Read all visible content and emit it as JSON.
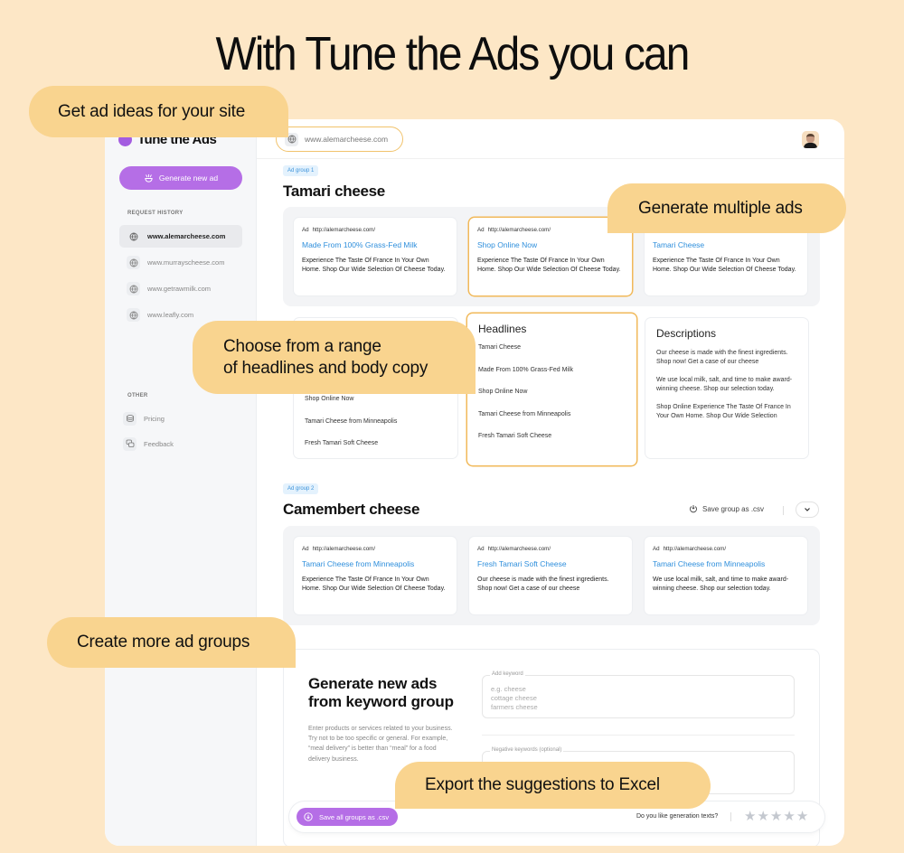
{
  "headline": "With Tune the Ads you can",
  "callouts": {
    "ideas": "Get ad ideas for your site",
    "multiple": "Generate multiple ads",
    "range_line1": "Choose from a range",
    "range_line2": "of headlines and body copy",
    "groups": "Create more ad groups",
    "export": "Export the suggestions to Excel"
  },
  "app": {
    "brand": "Tune the Ads",
    "generate_button": "Generate new ad",
    "request_history_label": "REQUEST HISTORY",
    "history": [
      {
        "url": "www.alemarcheese.com",
        "active": true
      },
      {
        "url": "www.murrayscheese.com",
        "active": false
      },
      {
        "url": "www.getrawmilk.com",
        "active": false
      },
      {
        "url": "www.leafly.com",
        "active": false
      }
    ],
    "other_label": "OTHER",
    "other_items": [
      {
        "label": "Pricing",
        "icon": "coins-icon"
      },
      {
        "label": "Feedback",
        "icon": "chat-icon"
      }
    ],
    "url_input": "www.alemarcheese.com",
    "groups": [
      {
        "tag": "Ad group 1",
        "title": "Tamari cheese",
        "ads": [
          {
            "ad_label": "Ad",
            "url": "http://alemarcheese.com/",
            "title": "Made From 100% Grass-Fed Milk",
            "body": "Experience The Taste Of France In Your Own Home. Shop Our Wide Selection Of Cheese Today."
          },
          {
            "ad_label": "Ad",
            "url": "http://alemarcheese.com/",
            "title": "Shop Online Now",
            "body": "Experience The Taste Of France In Your Own Home. Shop Our Wide Selection Of Cheese Today."
          },
          {
            "ad_label": "Ad",
            "url": "http://alemarcheese.com/",
            "title": "Tamari Cheese",
            "body": "Experience The Taste Of France In Your Own Home. Shop Our Wide Selection Of Cheese Today."
          }
        ],
        "left_list": [
          "Shop Online Now",
          "Tamari Cheese from Minneapolis",
          "Fresh Tamari Soft Cheese"
        ],
        "headlines_title": "Headlines",
        "headlines": [
          "Tamari Cheese",
          "Made From 100% Grass-Fed Milk",
          "Shop Online Now",
          "Tamari Cheese from Minneapolis",
          "Fresh Tamari Soft Cheese"
        ],
        "descriptions_title": "Descriptions",
        "descriptions": [
          "Our cheese is made with the finest ingredients. Shop now! Get a case of our cheese",
          "We use local milk, salt, and time to make award-winning cheese. Shop our selection today.",
          "Shop Online Experience The Taste Of France In Your Own Home. Shop Our Wide Selection"
        ]
      },
      {
        "tag": "Ad group 2",
        "title": "Camembert cheese",
        "save_label": "Save group as .csv",
        "ads": [
          {
            "ad_label": "Ad",
            "url": "http://alemarcheese.com/",
            "title": "Tamari Cheese from Minneapolis",
            "body": "Experience The Taste Of France In Your Own Home. Shop Our Wide Selection Of Cheese Today."
          },
          {
            "ad_label": "Ad",
            "url": "http://alemarcheese.com/",
            "title": "Fresh Tamari Soft Cheese",
            "body": "Our cheese is made with the finest ingredients. Shop now! Get a case of our cheese"
          },
          {
            "ad_label": "Ad",
            "url": "http://alemarcheese.com/",
            "title": "Tamari Cheese from Minneapolis",
            "body": "We use local milk, salt, and time to make award-winning cheese. Shop our selection today."
          }
        ]
      }
    ],
    "keyword_section": {
      "title": "Generate new ads from keyword group",
      "description": "Enter products or services related to your business. Try not to be too specific or general. For example, “meal delivery” is better than “meal” for a food delivery business.",
      "keyword_label": "Add keyword",
      "keyword_placeholder": "e.g. cheese\ncottage cheese\nfarmers cheese",
      "negative_label": "Negative keywords (optional)"
    },
    "bottom_bar": {
      "save_all": "Save all groups as .csv",
      "rating_question": "Do you like generation texts?",
      "rating_stars": 0,
      "rating_max": 5
    }
  }
}
